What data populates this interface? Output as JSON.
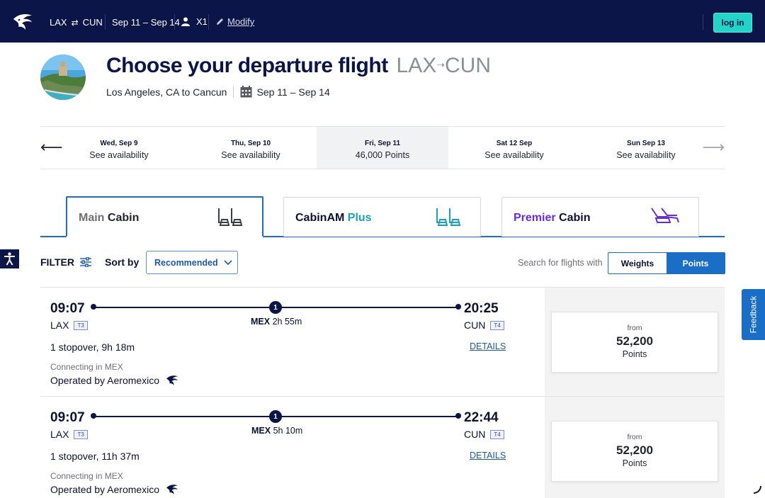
{
  "topbar": {
    "origin": "LAX",
    "swap_icon": "⇄",
    "destination": "CUN",
    "dates": "Sep 11 – Sep 14",
    "passengers": "X1",
    "modify": "Modify",
    "login": "log in"
  },
  "header": {
    "title": "Choose your departure flight",
    "route_origin": "LAX",
    "route_destination": "CUN",
    "subtitle": "Los Angeles, CA to Cancun",
    "dates": "Sep 11 – Sep 14"
  },
  "date_carousel": [
    {
      "day": "Wed, Sep 9",
      "value": "See availability",
      "active": false
    },
    {
      "day": "Thu, Sep 10",
      "value": "See availability",
      "active": false
    },
    {
      "day": "Fri, Sep 11",
      "value": "46,000 Points",
      "active": true
    },
    {
      "day": "Sat 12 Sep",
      "value": "See availability",
      "active": false
    },
    {
      "day": "Sun Sep 13",
      "value": "See availability",
      "active": false
    }
  ],
  "cabins": [
    {
      "part1": "Main",
      "part2": "Cabin",
      "active": true
    },
    {
      "part1": "CabinAM",
      "part2": "Plus",
      "active": false
    },
    {
      "part1": "Premier",
      "part2": "Cabin",
      "active": false
    }
  ],
  "filters": {
    "filter_label": "FILTER",
    "sort_label": "Sort by",
    "sort_value": "Recommended",
    "search_with_label": "Search for flights with",
    "options": [
      "Weights",
      "Points"
    ],
    "selected": "Points"
  },
  "feedback": "Feedback",
  "flights": [
    {
      "dep_time": "09:07",
      "arr_time": "20:25",
      "dep_airport": "LAX",
      "dep_terminal": "T3",
      "arr_airport": "CUN",
      "arr_terminal": "T4",
      "stop_count": "1",
      "via_airport": "MEX",
      "via_duration": "2h 55m",
      "summary": "1 stopover, 9h 18m",
      "details": "DETAILS",
      "connecting": "Connecting in MEX",
      "operated_by": "Operated by Aeromexico",
      "fare_from": "from",
      "fare_points": "52,200",
      "fare_unit": "Points"
    },
    {
      "dep_time": "09:07",
      "arr_time": "22:44",
      "dep_airport": "LAX",
      "dep_terminal": "T3",
      "arr_airport": "CUN",
      "arr_terminal": "T4",
      "stop_count": "1",
      "via_airport": "MEX",
      "via_duration": "5h 10m",
      "summary": "1 stopover, 11h 37m",
      "details": "DETAILS",
      "connecting": "Connecting in MEX",
      "operated_by": "Operated by Aeromexico",
      "fare_from": "from",
      "fare_points": "52,200",
      "fare_unit": "Points"
    }
  ],
  "colors": {
    "navy": "#0b1547",
    "accent_blue": "#1a6ec6",
    "teal": "#23d3c8",
    "plus_teal": "#1aa0b8",
    "premier_purple": "#6b2bd6"
  },
  "icons": [
    "eagle-logo-icon",
    "swap-icon",
    "person-icon",
    "pencil-icon",
    "calendar-icon",
    "arrow-left-icon",
    "arrow-right-icon",
    "seat-icon",
    "premier-seat-icon",
    "accessibility-icon",
    "filter-sliders-icon",
    "chevron-down-icon",
    "spinner-icon"
  ]
}
